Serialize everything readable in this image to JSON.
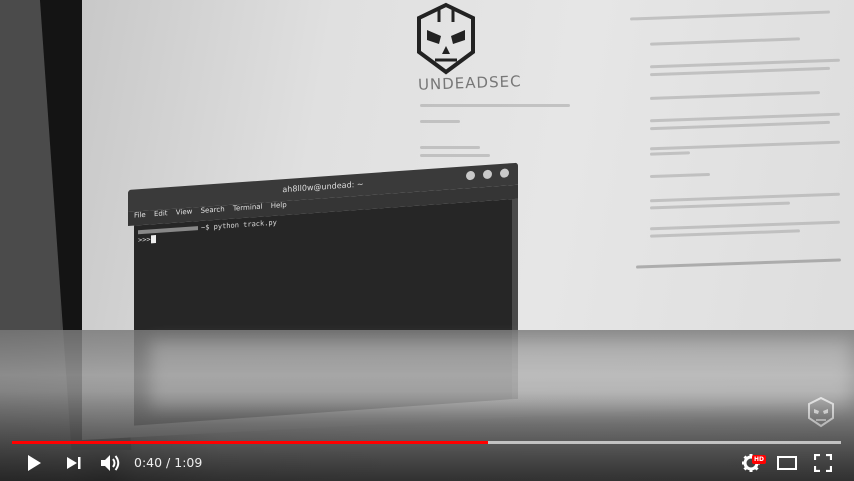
{
  "player": {
    "current_time": "0:40",
    "separator": " / ",
    "duration": "1:09",
    "progress_played_fraction": 0.574,
    "progress_loaded_fraction": 1.0,
    "quality_badge": "HD",
    "accent_color": "#ff0000"
  },
  "video_frame": {
    "logo_text": "UNDEADSEC",
    "terminal": {
      "title": "ah8ll0w@undead: ~",
      "menu": [
        "File",
        "Edit",
        "View",
        "Search",
        "Terminal",
        "Help"
      ],
      "command_line": "~$ python track.py",
      "prompt": ">>>"
    }
  },
  "icons": {
    "play": "play-icon",
    "next": "next-icon",
    "volume": "volume-icon",
    "settings": "gear-icon",
    "theater": "theater-mode-icon",
    "fullscreen": "fullscreen-icon",
    "watermark": "channel-watermark-icon"
  }
}
